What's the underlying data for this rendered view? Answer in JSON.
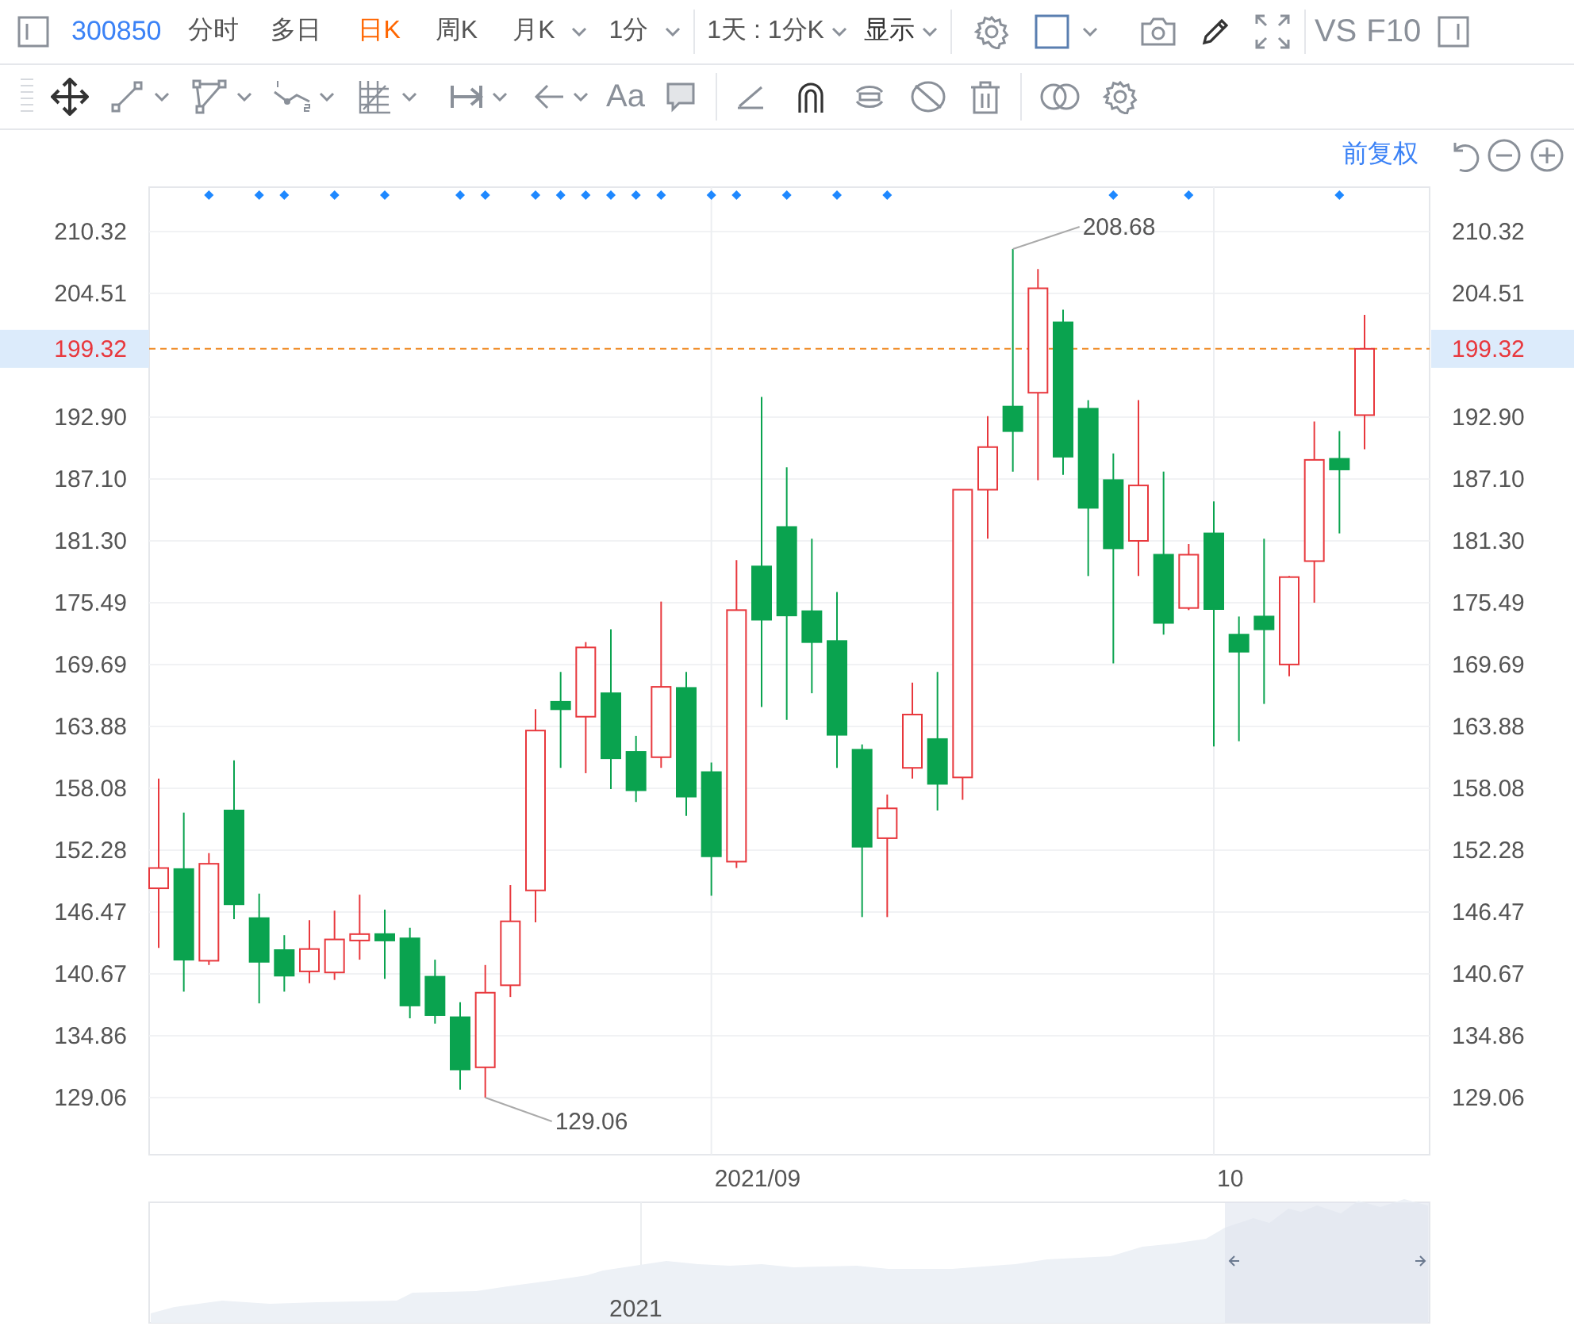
{
  "top_toolbar": {
    "stock_code": "300850",
    "periods": [
      {
        "label": "分时",
        "selected": false,
        "dropdown": false
      },
      {
        "label": "多日",
        "selected": false,
        "dropdown": false
      },
      {
        "label": "日K",
        "selected": true,
        "dropdown": false
      },
      {
        "label": "周K",
        "selected": false,
        "dropdown": false
      },
      {
        "label": "月K",
        "selected": false,
        "dropdown": true
      },
      {
        "label": "1分",
        "selected": false,
        "dropdown": true
      }
    ],
    "menus": [
      "1天 : 1分K",
      "显示"
    ],
    "text_buttons": [
      "VS",
      "F10"
    ]
  },
  "drawing_toolbar": {
    "text_tool": "Aa"
  },
  "chart_header": {
    "adjust_label": "前复权"
  },
  "main_chart": {
    "chart_data": {
      "type": "candlestick",
      "grid": true,
      "ohlc": [
        [
          148.7,
          159.0,
          143.1,
          150.6
        ],
        [
          150.5,
          155.8,
          139.0,
          142.0
        ],
        [
          141.9,
          152.0,
          141.5,
          151.0
        ],
        [
          156.0,
          160.7,
          145.8,
          147.2
        ],
        [
          145.9,
          148.2,
          137.9,
          141.8
        ],
        [
          142.9,
          144.3,
          139.0,
          140.5
        ],
        [
          140.9,
          145.7,
          139.8,
          143.0
        ],
        [
          140.8,
          146.6,
          140.1,
          143.9
        ],
        [
          143.8,
          148.1,
          142.0,
          144.4
        ],
        [
          144.4,
          146.7,
          140.2,
          143.8
        ],
        [
          144.0,
          145.0,
          136.5,
          137.7
        ],
        [
          140.4,
          142.0,
          136.0,
          136.8
        ],
        [
          136.6,
          138.0,
          129.8,
          131.7
        ],
        [
          131.9,
          141.5,
          129.06,
          138.9
        ],
        [
          139.6,
          149.0,
          138.5,
          145.6
        ],
        [
          148.5,
          165.5,
          145.5,
          163.5
        ],
        [
          166.2,
          169.0,
          160.0,
          165.5
        ],
        [
          164.8,
          171.8,
          159.5,
          171.3
        ],
        [
          167.0,
          173.0,
          158.0,
          160.9
        ],
        [
          161.5,
          163.0,
          156.8,
          157.9
        ],
        [
          161.0,
          175.6,
          160.0,
          167.6
        ],
        [
          167.5,
          169.0,
          155.5,
          157.3
        ],
        [
          159.6,
          160.5,
          148.0,
          151.7
        ],
        [
          151.2,
          179.5,
          150.6,
          174.8
        ],
        [
          178.9,
          194.8,
          165.7,
          173.9
        ],
        [
          182.6,
          188.2,
          164.5,
          174.3
        ],
        [
          174.7,
          181.5,
          167.0,
          171.8
        ],
        [
          171.9,
          176.5,
          160.0,
          163.1
        ],
        [
          161.7,
          162.2,
          146.0,
          152.6
        ],
        [
          153.4,
          157.5,
          146.0,
          156.2
        ],
        [
          160.0,
          168.0,
          159.0,
          165.0
        ],
        [
          162.7,
          169.0,
          156.0,
          158.5
        ],
        [
          159.1,
          186.1,
          157.0,
          186.1
        ],
        [
          186.1,
          193.0,
          181.5,
          190.1
        ],
        [
          193.9,
          208.68,
          187.8,
          191.6
        ],
        [
          195.2,
          206.8,
          187.0,
          205.0
        ],
        [
          201.8,
          203.0,
          187.5,
          189.2
        ],
        [
          193.7,
          194.5,
          178.0,
          184.4
        ],
        [
          187.0,
          189.5,
          169.8,
          180.6
        ],
        [
          181.3,
          194.5,
          178.0,
          186.5
        ],
        [
          180.0,
          187.8,
          172.5,
          173.6
        ],
        [
          175.0,
          181.0,
          174.8,
          180.0
        ],
        [
          182.0,
          185.0,
          162.0,
          174.9
        ],
        [
          172.5,
          174.2,
          162.5,
          170.9
        ],
        [
          174.2,
          181.5,
          166.0,
          173.0
        ],
        [
          169.7,
          178.0,
          168.6,
          177.9
        ],
        [
          179.4,
          192.5,
          175.5,
          188.9
        ],
        [
          189.0,
          191.6,
          182.0,
          188.0
        ],
        [
          193.1,
          202.5,
          189.9,
          199.32
        ]
      ],
      "ylim": [
        123.7,
        214.49
      ],
      "yticks": [
        {
          "value": 129.06,
          "label": "129.06"
        },
        {
          "value": 134.86,
          "label": "134.86"
        },
        {
          "value": 140.67,
          "label": "140.67"
        },
        {
          "value": 146.47,
          "label": "146.47"
        },
        {
          "value": 152.28,
          "label": "152.28"
        },
        {
          "value": 158.08,
          "label": "158.08"
        },
        {
          "value": 163.88,
          "label": "163.88"
        },
        {
          "value": 169.69,
          "label": "169.69"
        },
        {
          "value": 175.49,
          "label": "175.49"
        },
        {
          "value": 181.3,
          "label": "181.30"
        },
        {
          "value": 187.1,
          "label": "187.10"
        },
        {
          "value": 192.9,
          "label": "192.90"
        },
        {
          "value": 204.51,
          "label": "204.51"
        },
        {
          "value": 210.32,
          "label": "210.32"
        }
      ],
      "annotations": [
        "208.68",
        "129.06"
      ],
      "ref_lines": [
        {
          "axis": "y",
          "value": 199.32,
          "label": "199.32"
        }
      ]
    },
    "right_axis_labels": [
      "210.32",
      "204.51",
      "199.32",
      "192.90",
      "187.10",
      "181.30",
      "175.49",
      "169.69",
      "163.88",
      "158.08",
      "152.28",
      "146.47",
      "140.67",
      "134.86",
      "129.06"
    ],
    "x_axis_labels": [
      "2021/09",
      "10"
    ],
    "candle_signals": [
      {
        "marked": false
      },
      {
        "marked": false
      },
      {
        "marked": true
      },
      {
        "marked": false
      },
      {
        "marked": true
      },
      {
        "marked": true
      },
      {
        "marked": false
      },
      {
        "marked": true
      },
      {
        "marked": false
      },
      {
        "marked": true
      },
      {
        "marked": false
      },
      {
        "marked": false
      },
      {
        "marked": true
      },
      {
        "marked": true
      },
      {
        "marked": false
      },
      {
        "marked": true
      },
      {
        "marked": true
      },
      {
        "marked": true
      },
      {
        "marked": true
      },
      {
        "marked": true
      },
      {
        "marked": true
      },
      {
        "marked": false
      },
      {
        "marked": true
      },
      {
        "marked": true
      },
      {
        "marked": false
      },
      {
        "marked": true
      },
      {
        "marked": false
      },
      {
        "marked": true
      },
      {
        "marked": false
      },
      {
        "marked": true
      },
      {
        "marked": false
      },
      {
        "marked": false
      },
      {
        "marked": false
      },
      {
        "marked": false
      },
      {
        "marked": false
      },
      {
        "marked": false
      },
      {
        "marked": false
      },
      {
        "marked": false
      },
      {
        "marked": true
      },
      {
        "marked": false
      },
      {
        "marked": false
      },
      {
        "marked": true
      },
      {
        "marked": false
      },
      {
        "marked": false
      },
      {
        "marked": false
      },
      {
        "marked": false
      },
      {
        "marked": false
      },
      {
        "marked": true
      },
      {
        "marked": false
      }
    ]
  },
  "navigator": {
    "year_label": "2021"
  }
}
